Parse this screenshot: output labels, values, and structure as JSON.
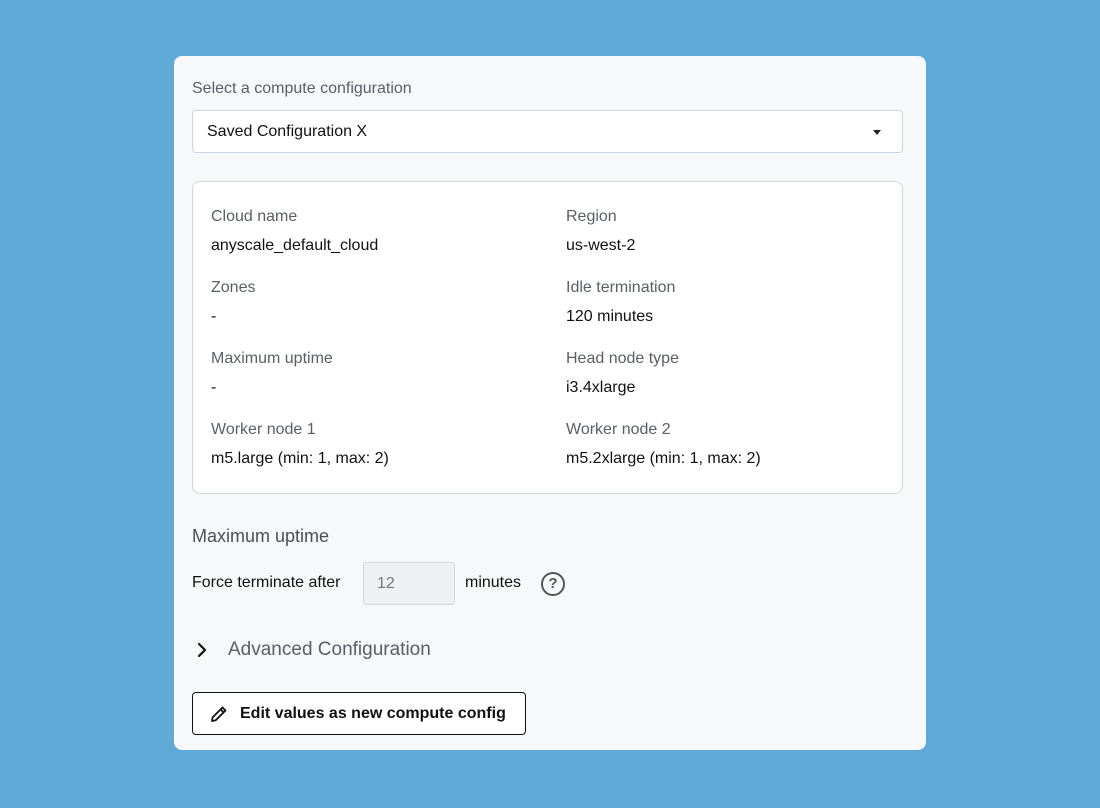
{
  "compute": {
    "select_label": "Select a compute configuration",
    "selected": "Saved Configuration X"
  },
  "details": {
    "cloud_name": {
      "label": "Cloud name",
      "value": "anyscale_default_cloud"
    },
    "region": {
      "label": "Region",
      "value": "us-west-2"
    },
    "zones": {
      "label": "Zones",
      "value": "-"
    },
    "idle_termination": {
      "label": "Idle termination",
      "value": "120 minutes"
    },
    "maximum_uptime": {
      "label": "Maximum uptime",
      "value": "-"
    },
    "head_node_type": {
      "label": "Head node type",
      "value": "i3.4xlarge"
    },
    "worker_node_1": {
      "label": "Worker node 1",
      "value": "m5.large (min: 1, max: 2)"
    },
    "worker_node_2": {
      "label": "Worker node 2",
      "value": "m5.2xlarge (min: 1, max: 2)"
    }
  },
  "max_uptime": {
    "title": "Maximum uptime",
    "force_label": "Force terminate after",
    "input_value": "12",
    "unit": "minutes",
    "help_icon": "?"
  },
  "advanced": {
    "label": "Advanced Configuration",
    "icon": "chevron-right-icon"
  },
  "edit": {
    "label": "Edit values as new compute config",
    "icon": "pencil-icon"
  },
  "colors": {
    "background": "#5fa9d6",
    "card": "#f6f8fa"
  }
}
